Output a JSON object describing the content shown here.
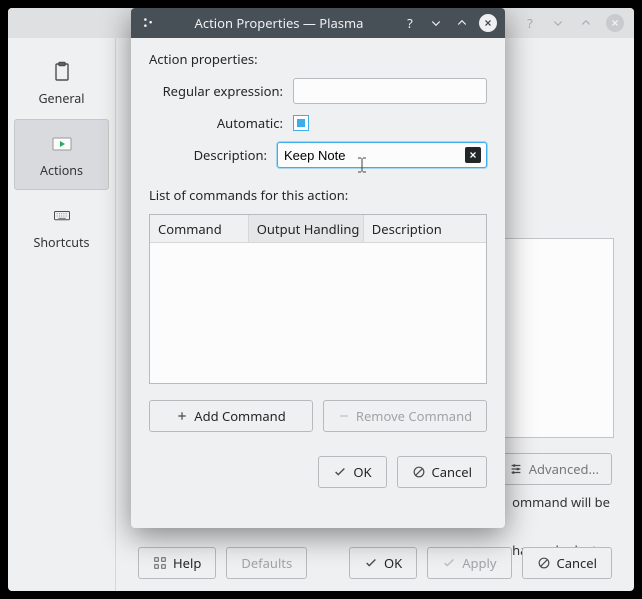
{
  "bg_window": {
    "sidebar": {
      "items": [
        {
          "label": "General"
        },
        {
          "label": "Actions"
        },
        {
          "label": "Shortcuts"
        }
      ]
    },
    "advanced_btn": "Advanced...",
    "hint_line1": "ommand will be",
    "hint_line2": "have a look at",
    "buttons": {
      "help": "Help",
      "defaults": "Defaults",
      "ok": "OK",
      "apply": "Apply",
      "cancel": "Cancel"
    }
  },
  "dialog": {
    "title": "Action Properties — Plasma",
    "heading": "Action properties:",
    "labels": {
      "regex": "Regular expression:",
      "automatic": "Automatic:",
      "description": "Description:"
    },
    "values": {
      "regex": "",
      "automatic_checked": true,
      "description": "Keep Note"
    },
    "commands_heading": "List of commands for this action:",
    "columns": {
      "command": "Command",
      "output": "Output Handling",
      "description": "Description"
    },
    "buttons": {
      "add": "Add Command",
      "remove": "Remove Command",
      "ok": "OK",
      "cancel": "Cancel"
    }
  }
}
